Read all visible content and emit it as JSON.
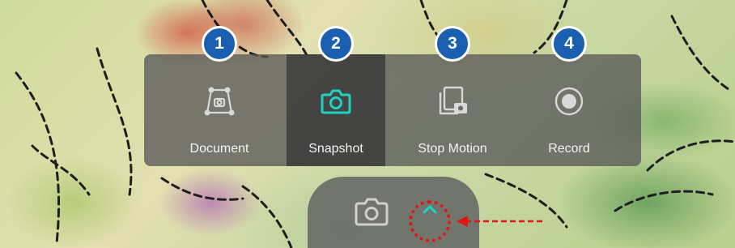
{
  "modes": [
    {
      "badge": "1",
      "label": "Document",
      "icon": "document-scan-icon"
    },
    {
      "badge": "2",
      "label": "Snapshot",
      "icon": "camera-icon"
    },
    {
      "badge": "3",
      "label": "Stop Motion",
      "icon": "stop-motion-icon"
    },
    {
      "badge": "4",
      "label": "Record",
      "icon": "record-icon"
    }
  ],
  "active_mode": "Snapshot",
  "bottom_bar": {
    "icon": "camera-icon",
    "toggle_icon": "chevron-up-icon"
  },
  "annotation": {
    "type": "dotted-circle-with-arrow",
    "color": "#e01616"
  },
  "colors": {
    "accent": "#1dd3c4",
    "badge": "#1b5fb0",
    "panel": "#585858",
    "annotation": "#e01616"
  }
}
